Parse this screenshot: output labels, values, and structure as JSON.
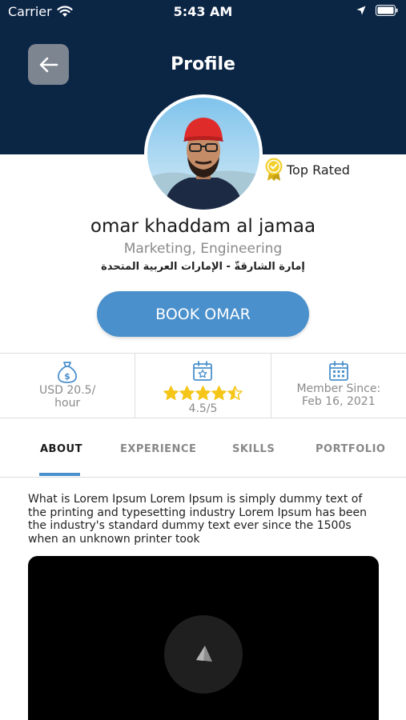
{
  "status_bar": {
    "carrier": "Carrier",
    "time": "5:43 AM"
  },
  "header": {
    "title": "Profile"
  },
  "profile": {
    "badge": "Top Rated",
    "name": "omar khaddam al jamaa",
    "skills": "Marketing, Engineering",
    "location": "إمارة الشارقةّ - الإمارات العربية المتحدة"
  },
  "book_button": {
    "label": "BOOK OMAR"
  },
  "stats": {
    "rate": {
      "line1": "USD 20.5/",
      "line2": "hour"
    },
    "rating": {
      "value": 4.5,
      "max": 5,
      "label": "4.5/5"
    },
    "member": {
      "line1": "Member Since:",
      "line2": "Feb 16, 2021"
    }
  },
  "tabs": [
    {
      "label": "ABOUT",
      "active": true
    },
    {
      "label": "EXPERIENCE",
      "active": false
    },
    {
      "label": "SKILLS",
      "active": false
    },
    {
      "label": "PORTFOLIO",
      "active": false
    }
  ],
  "about": {
    "text": "What is Lorem Ipsum Lorem Ipsum is simply dummy text of the printing and typesetting industry Lorem Ipsum has been the industry's standard dummy text ever since the 1500s when an unknown printer took"
  },
  "colors": {
    "header": "#0b2545",
    "accent": "#4a90cc",
    "star": "#f5c518"
  }
}
